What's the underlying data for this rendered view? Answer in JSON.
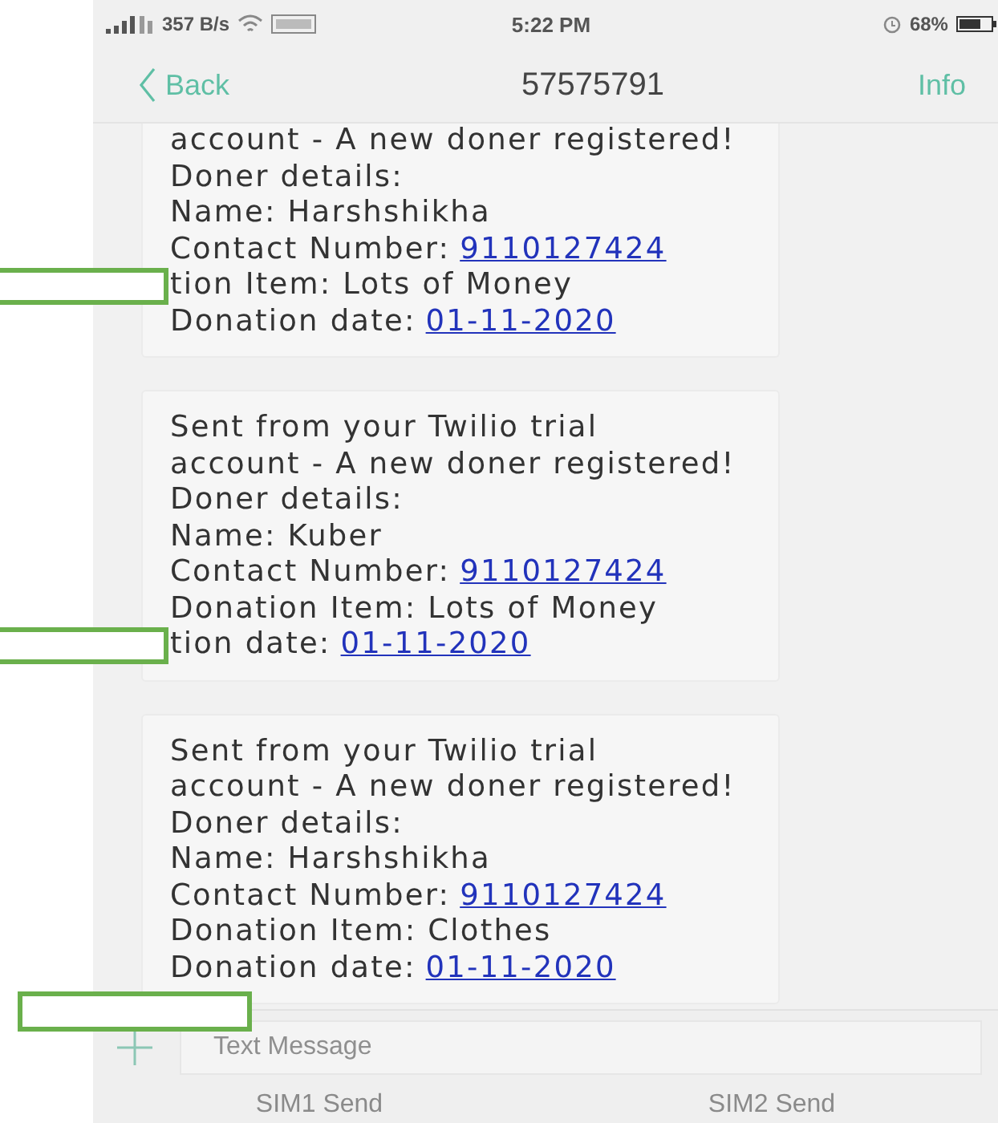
{
  "status_bar": {
    "speed": "357 B/s",
    "time": "5:22 PM",
    "battery": "68%"
  },
  "nav": {
    "back": "Back",
    "title": "57575791",
    "info": "Info"
  },
  "messages": [
    {
      "marked_after": false,
      "lines": [
        {
          "text": "account - A new doner registered!",
          "marked": false
        },
        {
          "text": "Doner details:",
          "marked": false
        },
        {
          "text": "Name: Harshshikha",
          "marked": false
        },
        {
          "text": "Contact Number:",
          "link": "9110127424",
          "marked": false
        },
        {
          "text": "tion Item: Lots of Money",
          "marked": true
        },
        {
          "text": "Donation date:",
          "link": "01-11-2020",
          "marked": false
        }
      ]
    },
    {
      "marked_after": false,
      "lines": [
        {
          "text": "Sent from your Twilio trial",
          "marked": false
        },
        {
          "text": "account - A new doner registered!",
          "marked": false
        },
        {
          "text": "Doner details:",
          "marked": false
        },
        {
          "text": "Name: Kuber",
          "marked": false
        },
        {
          "text": "Contact Number:",
          "link": "9110127424",
          "marked": false
        },
        {
          "text": "Donation Item: Lots of Money",
          "marked": false
        },
        {
          "text": "tion date:",
          "link": "01-11-2020",
          "marked": true
        }
      ]
    },
    {
      "marked_after": true,
      "lines": [
        {
          "text": "Sent from your Twilio trial",
          "marked": false
        },
        {
          "text": "account - A new doner registered!",
          "marked": false
        },
        {
          "text": "Doner details:",
          "marked": false
        },
        {
          "text": "Name: Harshshikha",
          "marked": false
        },
        {
          "text": "Contact Number:",
          "link": "9110127424",
          "marked": false
        },
        {
          "text": "Donation Item: Clothes",
          "marked": false
        },
        {
          "text": "Donation date:",
          "link": "01-11-2020",
          "marked": false
        }
      ]
    }
  ],
  "composer": {
    "placeholder": "Text Message"
  },
  "send_buttons": [
    {
      "label": "SIM1 Send",
      "disabled": true
    },
    {
      "label": "SIM2 Send",
      "disabled": true
    }
  ]
}
